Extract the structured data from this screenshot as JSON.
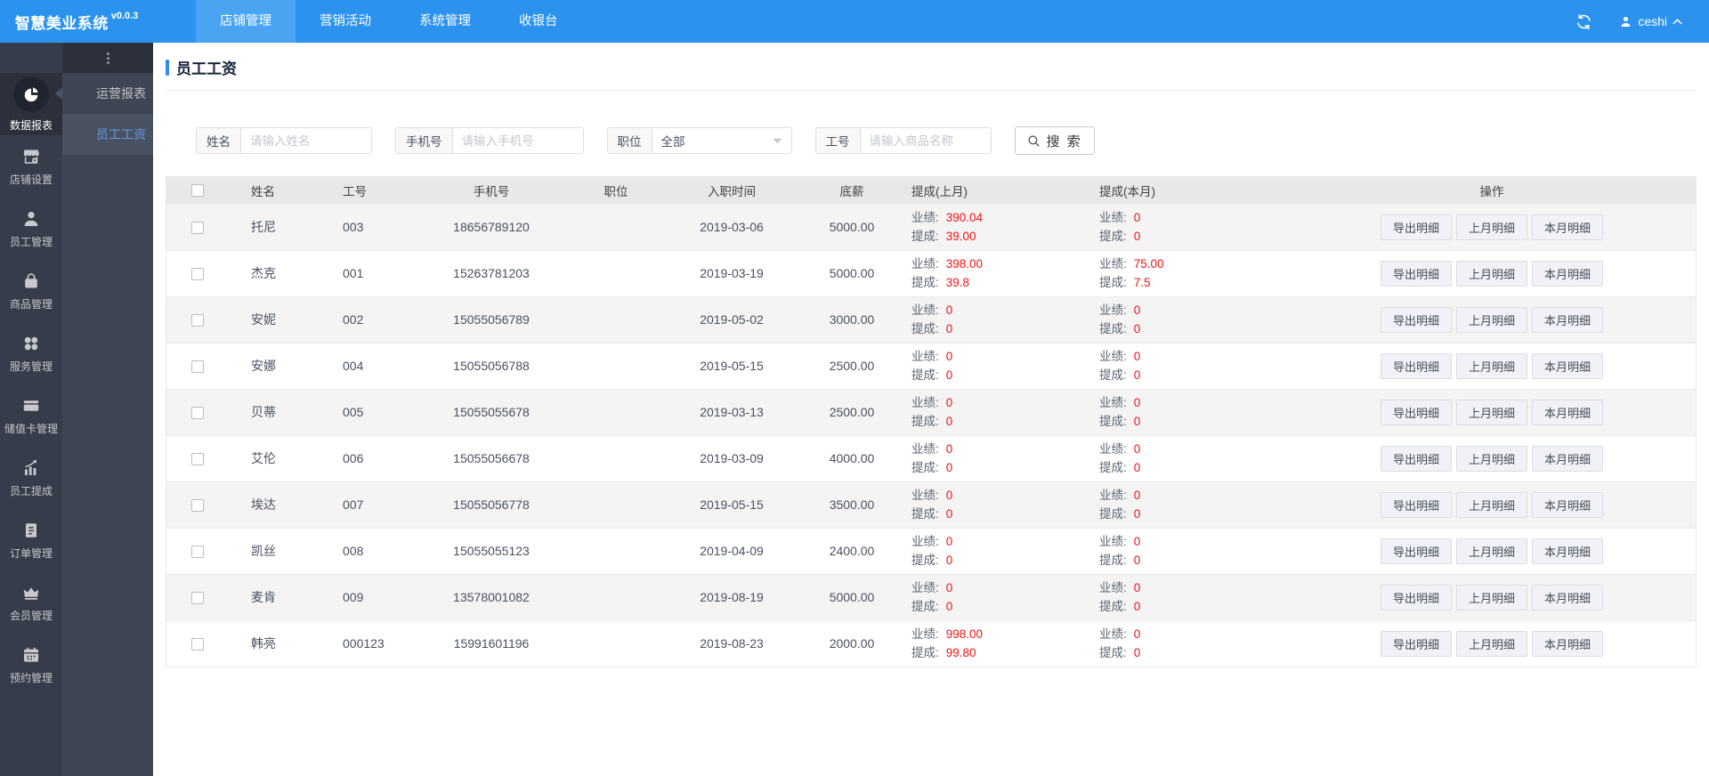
{
  "colors": {
    "navbar_blue": "#2b93ee",
    "navbar_active_blue": "#4aa4f2",
    "accent_blue": "#2d8cf0",
    "value_red": "#f01313",
    "sidebar_dark": "#363c4a"
  },
  "navbar": {
    "logo": "智慧美业系统",
    "version": "v0.0.3",
    "menus": [
      {
        "label": "店铺管理",
        "active": true
      },
      {
        "label": "营销活动",
        "active": false
      },
      {
        "label": "系统管理",
        "active": false
      },
      {
        "label": "收银台",
        "active": false
      }
    ],
    "refresh_icon": "refresh-icon",
    "user": {
      "icon": "user-avatar-icon",
      "name": "ceshi",
      "caret_icon": "chevron-up-icon"
    }
  },
  "sidebar": {
    "items": [
      {
        "icon": "pie-chart-icon",
        "label": "数据报表",
        "active": true
      },
      {
        "icon": "storefront-icon",
        "label": "店铺设置",
        "active": false
      },
      {
        "icon": "user-icon",
        "label": "员工管理",
        "active": false
      },
      {
        "icon": "shopping-bag-icon",
        "label": "商品管理",
        "active": false
      },
      {
        "icon": "services-icon",
        "label": "服务管理",
        "active": false
      },
      {
        "icon": "stored-value-card-icon",
        "label": "储值卡管理",
        "active": false
      },
      {
        "icon": "commission-chart-icon",
        "label": "员工提成",
        "active": false
      },
      {
        "icon": "order-clipboard-icon",
        "label": "订单管理",
        "active": false
      },
      {
        "icon": "member-crown-icon",
        "label": "会员管理",
        "active": false
      },
      {
        "icon": "appointment-calendar-icon",
        "label": "预约管理",
        "active": false
      }
    ]
  },
  "submenu": {
    "handle_icon": "vertical-dots-icon",
    "items": [
      {
        "label": "运营报表",
        "active": false
      },
      {
        "label": "员工工资",
        "active": true
      }
    ]
  },
  "page": {
    "title": "员工工资"
  },
  "search": {
    "fields": [
      {
        "label": "姓名",
        "type": "input",
        "placeholder": "请输入姓名",
        "value": "",
        "control_name": "name-input"
      },
      {
        "label": "手机号",
        "type": "input",
        "placeholder": "请输入手机号",
        "value": "",
        "control_name": "phone-input"
      },
      {
        "label": "职位",
        "type": "select",
        "value": "全部",
        "control_name": "position-select"
      },
      {
        "label": "工号",
        "type": "input",
        "placeholder": "请输入商品名称",
        "value": "",
        "control_name": "employee-code-input"
      }
    ],
    "button_label": "搜 索",
    "button_icon": "magnifier-icon"
  },
  "table": {
    "headers": [
      "",
      "姓名",
      "工号",
      "手机号",
      "职位",
      "入职时间",
      "底薪",
      "提成(上月)",
      "提成(本月)",
      "操作"
    ],
    "row_labels": {
      "performance": "业绩:",
      "commission": "提成:"
    },
    "action_buttons": [
      "导出明细",
      "上月明细",
      "本月明细"
    ],
    "rows": [
      {
        "name": "托尼",
        "code": "003",
        "phone": "18656789120",
        "position": "",
        "join_date": "2019-03-06",
        "base_salary": "5000.00",
        "last_month": {
          "performance": "390.04",
          "commission": "39.00"
        },
        "this_month": {
          "performance": "0",
          "commission": "0"
        }
      },
      {
        "name": "杰克",
        "code": "001",
        "phone": "15263781203",
        "position": "",
        "join_date": "2019-03-19",
        "base_salary": "5000.00",
        "last_month": {
          "performance": "398.00",
          "commission": "39.8"
        },
        "this_month": {
          "performance": "75.00",
          "commission": "7.5"
        }
      },
      {
        "name": "安妮",
        "code": "002",
        "phone": "15055056789",
        "position": "",
        "join_date": "2019-05-02",
        "base_salary": "3000.00",
        "last_month": {
          "performance": "0",
          "commission": "0"
        },
        "this_month": {
          "performance": "0",
          "commission": "0"
        }
      },
      {
        "name": "安娜",
        "code": "004",
        "phone": "15055056788",
        "position": "",
        "join_date": "2019-05-15",
        "base_salary": "2500.00",
        "last_month": {
          "performance": "0",
          "commission": "0"
        },
        "this_month": {
          "performance": "0",
          "commission": "0"
        }
      },
      {
        "name": "贝蒂",
        "code": "005",
        "phone": "15055055678",
        "position": "",
        "join_date": "2019-03-13",
        "base_salary": "2500.00",
        "last_month": {
          "performance": "0",
          "commission": "0"
        },
        "this_month": {
          "performance": "0",
          "commission": "0"
        }
      },
      {
        "name": "艾伦",
        "code": "006",
        "phone": "15055056678",
        "position": "",
        "join_date": "2019-03-09",
        "base_salary": "4000.00",
        "last_month": {
          "performance": "0",
          "commission": "0"
        },
        "this_month": {
          "performance": "0",
          "commission": "0"
        }
      },
      {
        "name": "埃达",
        "code": "007",
        "phone": "15055056778",
        "position": "",
        "join_date": "2019-05-15",
        "base_salary": "3500.00",
        "last_month": {
          "performance": "0",
          "commission": "0"
        },
        "this_month": {
          "performance": "0",
          "commission": "0"
        }
      },
      {
        "name": "凯丝",
        "code": "008",
        "phone": "15055055123",
        "position": "",
        "join_date": "2019-04-09",
        "base_salary": "2400.00",
        "last_month": {
          "performance": "0",
          "commission": "0"
        },
        "this_month": {
          "performance": "0",
          "commission": "0"
        }
      },
      {
        "name": "麦肯",
        "code": "009",
        "phone": "13578001082",
        "position": "",
        "join_date": "2019-08-19",
        "base_salary": "5000.00",
        "last_month": {
          "performance": "0",
          "commission": "0"
        },
        "this_month": {
          "performance": "0",
          "commission": "0"
        }
      },
      {
        "name": "韩亮",
        "code": "000123",
        "phone": "15991601196",
        "position": "",
        "join_date": "2019-08-23",
        "base_salary": "2000.00",
        "last_month": {
          "performance": "998.00",
          "commission": "99.80"
        },
        "this_month": {
          "performance": "0",
          "commission": "0"
        }
      }
    ]
  }
}
